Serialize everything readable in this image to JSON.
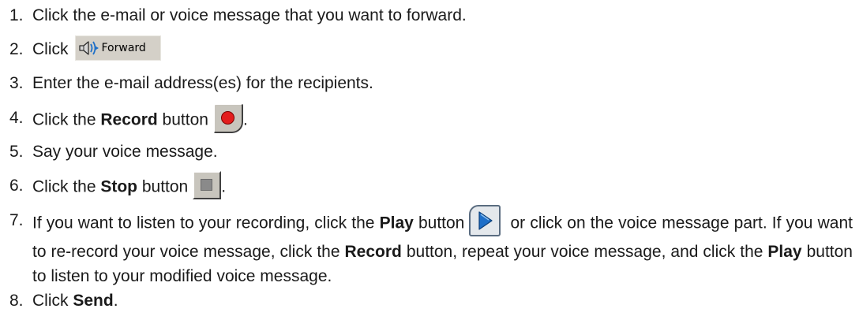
{
  "steps": [
    {
      "num": "1.",
      "text": "Click the e-mail or voice message that you want to forward."
    },
    {
      "num": "2.",
      "pre": "Click",
      "button_label": "Forward"
    },
    {
      "num": "3.",
      "text": "Enter the e-mail address(es) for the recipients."
    },
    {
      "num": "4.",
      "pre": "Click the ",
      "bold": "Record",
      "post": " button",
      "end": "."
    },
    {
      "num": "5.",
      "text": "Say your voice message."
    },
    {
      "num": "6.",
      "pre": "Click the ",
      "bold": "Stop",
      "post": " button",
      "end": "."
    },
    {
      "num": "7.",
      "a": "If you want to listen to your recording, click the ",
      "b": "Play",
      "c": " button",
      "d": " or click on the voice message part. If you want to re-record your voice message, click the ",
      "e": "Record",
      "f": " button, repeat your voice message, and click the ",
      "g": "Play",
      "h": " button to listen to your modified voice message."
    },
    {
      "num": "8.",
      "pre": "Click ",
      "bold": "Send",
      "end": "."
    }
  ],
  "icons": {
    "forward": "speaker-forward-icon",
    "record": "record-icon",
    "stop": "stop-icon",
    "play": "play-icon"
  },
  "colors": {
    "record_red": "#e31d1d",
    "button_gray": "#d4d0c8",
    "play_blue": "#1e6fc8"
  }
}
